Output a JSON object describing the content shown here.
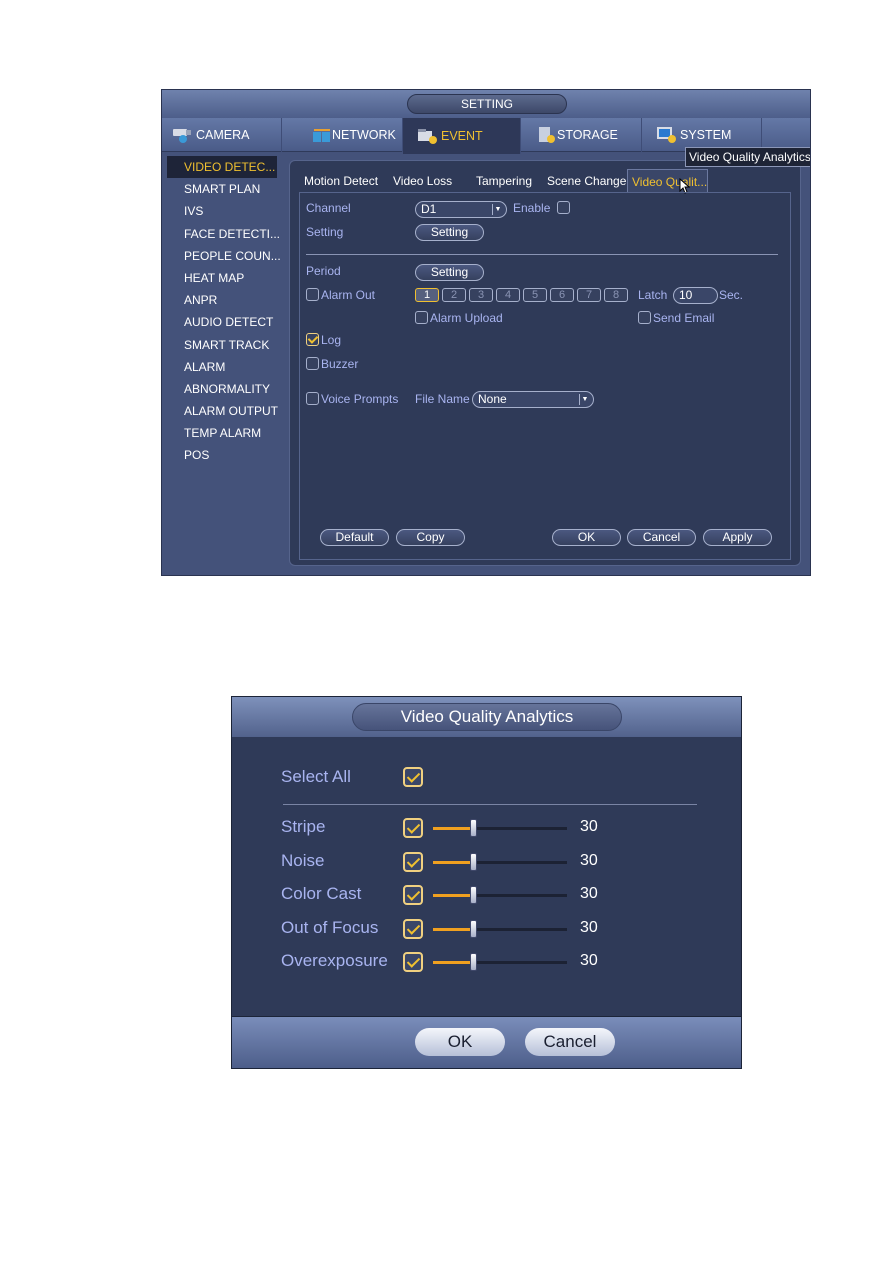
{
  "window": {
    "title": "SETTING",
    "main_tabs": [
      {
        "label": "CAMERA",
        "icon": "camera-icon"
      },
      {
        "label": "NETWORK",
        "icon": "network-icon"
      },
      {
        "label": "EVENT",
        "icon": "event-icon",
        "active": true
      },
      {
        "label": "STORAGE",
        "icon": "storage-icon"
      },
      {
        "label": "SYSTEM",
        "icon": "system-icon"
      }
    ],
    "tooltip": "Video Quality Analytics",
    "sidebar": [
      {
        "label": "VIDEO DETEC...",
        "active": true
      },
      {
        "label": "SMART PLAN"
      },
      {
        "label": "IVS"
      },
      {
        "label": "FACE DETECTI..."
      },
      {
        "label": "PEOPLE COUN..."
      },
      {
        "label": "HEAT MAP"
      },
      {
        "label": "ANPR"
      },
      {
        "label": "AUDIO DETECT"
      },
      {
        "label": "SMART TRACK"
      },
      {
        "label": "ALARM"
      },
      {
        "label": "ABNORMALITY"
      },
      {
        "label": "ALARM OUTPUT"
      },
      {
        "label": "TEMP ALARM"
      },
      {
        "label": "POS"
      }
    ],
    "sub_tabs": [
      {
        "label": "Motion Detect"
      },
      {
        "label": "Video Loss"
      },
      {
        "label": "Tampering"
      },
      {
        "label": "Scene Change"
      },
      {
        "label": "Video Qualit...",
        "active": true
      }
    ],
    "form": {
      "channel_label": "Channel",
      "channel_value": "D1",
      "enable_label": "Enable",
      "enable_checked": false,
      "setting_label": "Setting",
      "setting_button": "Setting",
      "period_label": "Period",
      "period_button": "Setting",
      "alarm_out_label": "Alarm Out",
      "alarm_out_checked": false,
      "alarm_channels": [
        "1",
        "2",
        "3",
        "4",
        "5",
        "6",
        "7",
        "8"
      ],
      "alarm_channel_selected": "1",
      "latch_label": "Latch",
      "latch_value": "10",
      "latch_unit": "Sec.",
      "alarm_upload_label": "Alarm Upload",
      "alarm_upload_checked": false,
      "send_email_label": "Send Email",
      "send_email_checked": false,
      "log_label": "Log",
      "log_checked": true,
      "buzzer_label": "Buzzer",
      "buzzer_checked": false,
      "voice_prompts_label": "Voice Prompts",
      "voice_prompts_checked": false,
      "file_name_label": "File Name",
      "file_name_value": "None"
    },
    "buttons": {
      "default": "Default",
      "copy": "Copy",
      "ok": "OK",
      "cancel": "Cancel",
      "apply": "Apply"
    }
  },
  "dialog": {
    "title": "Video Quality Analytics",
    "select_all_label": "Select All",
    "select_all_checked": true,
    "items": [
      {
        "label": "Stripe",
        "checked": true,
        "value": 30,
        "max": 100
      },
      {
        "label": "Noise",
        "checked": true,
        "value": 30,
        "max": 100
      },
      {
        "label": "Color Cast",
        "checked": true,
        "value": 30,
        "max": 100
      },
      {
        "label": "Out of Focus",
        "checked": true,
        "value": 30,
        "max": 100
      },
      {
        "label": "Overexposure",
        "checked": true,
        "value": 30,
        "max": 100
      }
    ],
    "ok_label": "OK",
    "cancel_label": "Cancel"
  },
  "colors": {
    "accent": "#f0c030",
    "label_blue": "#a9b4f0",
    "panel_bg": "#2f3a58"
  }
}
